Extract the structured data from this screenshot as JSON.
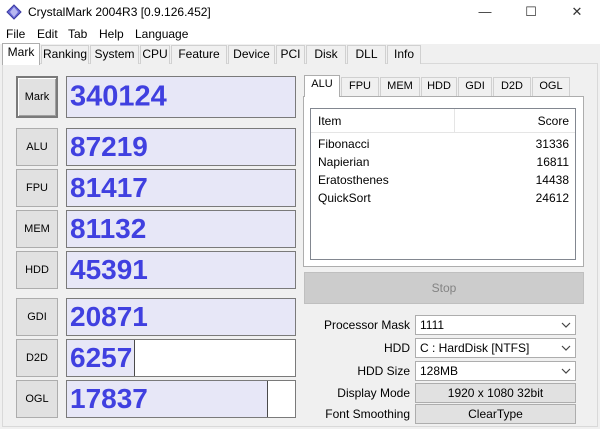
{
  "window": {
    "title": "CrystalMark 2004R3 [0.9.126.452]",
    "minimize": "—",
    "maximize": "☐",
    "close": "✕"
  },
  "menu": [
    "File",
    "Edit",
    "Tab",
    "Help",
    "Language"
  ],
  "tabs": [
    "Mark",
    "Ranking",
    "System",
    "CPU",
    "Feature",
    "Device",
    "PCI",
    "Disk",
    "DLL",
    "Info"
  ],
  "active_tab": "Mark",
  "marks": {
    "main": {
      "label": "Mark",
      "value": "340124"
    },
    "items": [
      {
        "label": "ALU",
        "value": "87219",
        "fill": 1.0
      },
      {
        "label": "FPU",
        "value": "81417",
        "fill": 1.0
      },
      {
        "label": "MEM",
        "value": "81132",
        "fill": 1.0
      },
      {
        "label": "HDD",
        "value": "45391",
        "fill": 1.0
      },
      {
        "label": "GDI",
        "value": "20871",
        "fill": 1.0
      },
      {
        "label": "D2D",
        "value": "6257",
        "fill": 0.3
      },
      {
        "label": "OGL",
        "value": "17837",
        "fill": 0.88
      }
    ]
  },
  "inner_tabs": [
    "ALU",
    "FPU",
    "MEM",
    "HDD",
    "GDI",
    "D2D",
    "OGL"
  ],
  "active_inner_tab": "ALU",
  "results": {
    "headers": {
      "item": "Item",
      "score": "Score"
    },
    "rows": [
      {
        "item": "Fibonacci",
        "score": "31336"
      },
      {
        "item": "Napierian",
        "score": "16811"
      },
      {
        "item": "Eratosthenes",
        "score": "14438"
      },
      {
        "item": "QuickSort",
        "score": "24612"
      }
    ]
  },
  "stop_label": "Stop",
  "settings": {
    "processor_mask_label": "Processor Mask",
    "processor_mask_value": "1111",
    "hdd_label": "HDD",
    "hdd_value": "C : HardDisk [NTFS]",
    "hdd_size_label": "HDD Size",
    "hdd_size_value": "128MB",
    "display_mode_label": "Display Mode",
    "display_mode_value": "1920 x 1080 32bit",
    "font_smoothing_label": "Font Smoothing",
    "font_smoothing_value": "ClearType"
  },
  "colors": {
    "score_text": "#4040e0",
    "bar_fill": "#e7e7f7"
  }
}
